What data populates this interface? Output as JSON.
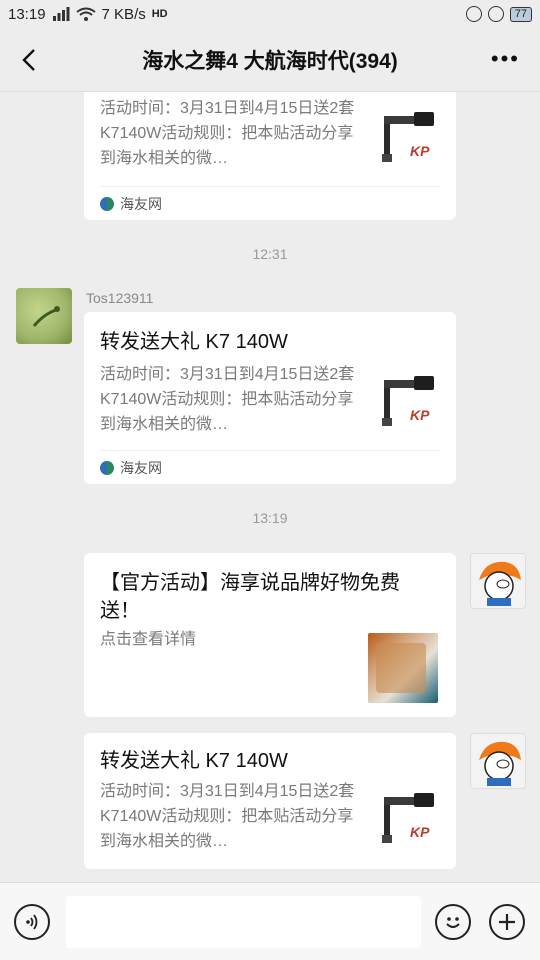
{
  "status": {
    "time": "13:19",
    "net_speed": "7 KB/s",
    "hd_label": "HD",
    "battery": "77"
  },
  "header": {
    "title": "海水之舞4 大航海时代(394)"
  },
  "messages": [
    {
      "desc": "活动时间：3月31日到4月15日送2套K7140W活动规则：把本贴活动分享到海水相关的微…",
      "source": "海友网",
      "thumb_caption": "KP"
    },
    {
      "time": "12:31"
    },
    {
      "sender": "Tos123911",
      "title": "转发送大礼 K7 140W",
      "desc": "活动时间：3月31日到4月15日送2套K7140W活动规则：把本贴活动分享到海水相关的微…",
      "source": "海友网",
      "thumb_caption": "KP"
    },
    {
      "time": "13:19"
    },
    {
      "title": "【官方活动】海享说品牌好物免费送！",
      "desc": "点击查看详情"
    },
    {
      "title": "转发送大礼 K7 140W",
      "desc": "活动时间：3月31日到4月15日送2套K7140W活动规则：把本贴活动分享到海水相关的微…",
      "thumb_caption": "KP"
    }
  ],
  "colors": {
    "background": "#ededed",
    "card": "#ffffff",
    "muted_text": "#7a7a7a",
    "time_text": "#999999"
  },
  "icons": [
    "back-arrow-icon",
    "more-icon",
    "voice-icon",
    "emoji-icon",
    "plus-icon",
    "wifi-icon",
    "signal-icon",
    "source-logo-icon"
  ]
}
